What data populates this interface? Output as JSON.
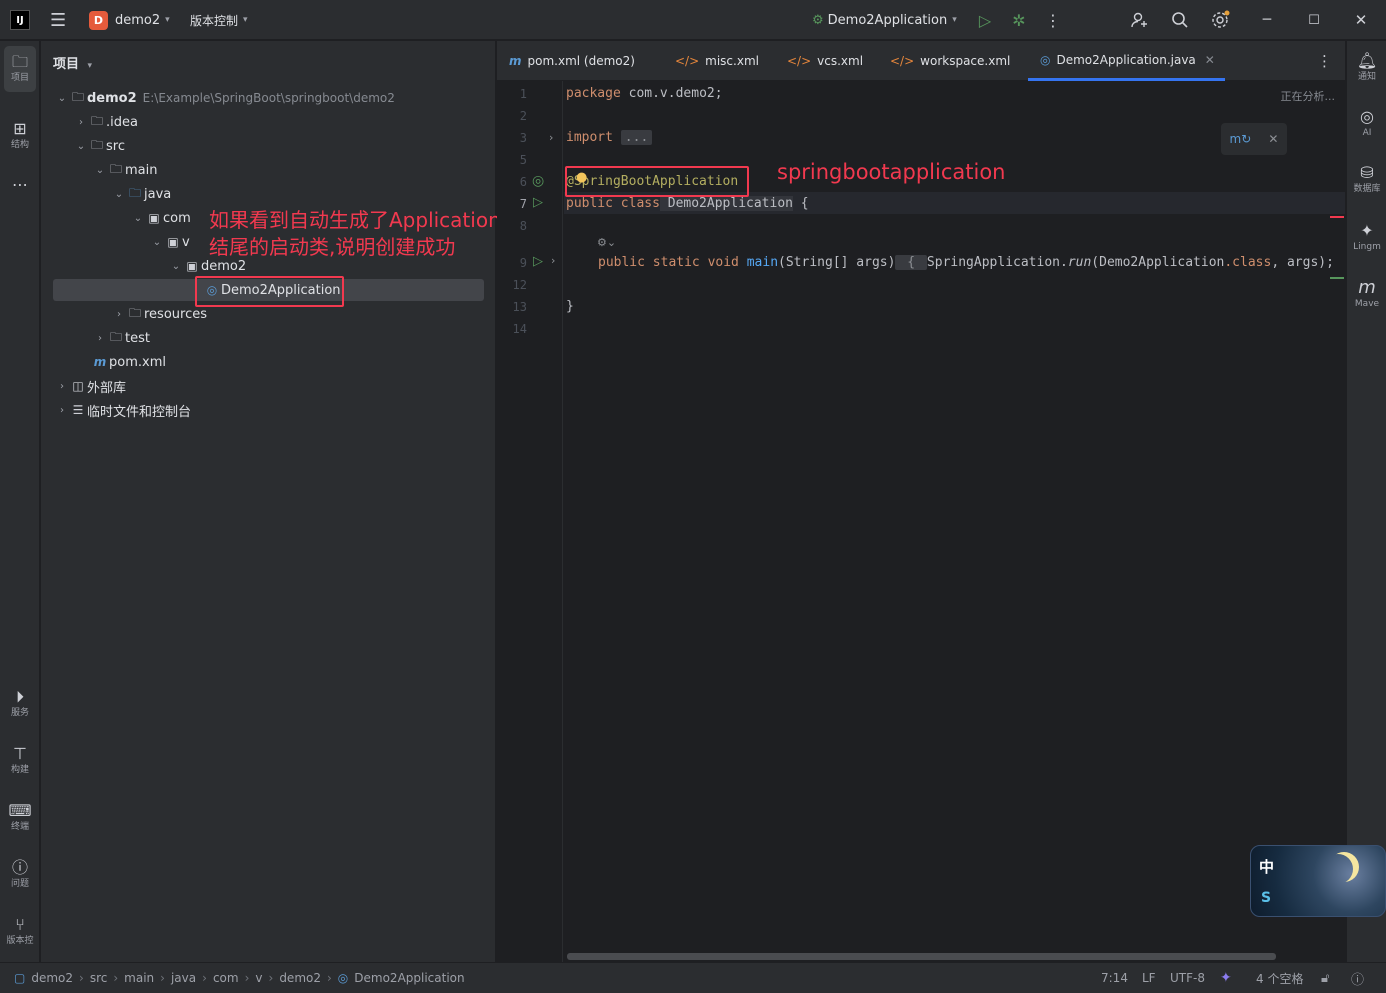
{
  "titlebar": {
    "logo": "IJ",
    "project_badge": "D",
    "project_name": "demo2",
    "vcs_label": "版本控制",
    "run_config": "Demo2Application"
  },
  "left_strip": {
    "items": [
      {
        "label": "项目",
        "icon": "folder-icon"
      },
      {
        "label": "结构",
        "icon": "structure-icon"
      },
      {
        "label": "服务",
        "icon": "services-icon"
      },
      {
        "label": "构建",
        "icon": "build-icon"
      },
      {
        "label": "终端",
        "icon": "terminal-icon"
      },
      {
        "label": "问题",
        "icon": "problems-icon"
      },
      {
        "label": "版本控",
        "icon": "git-icon"
      }
    ]
  },
  "project_panel": {
    "title": "项目",
    "tree": [
      {
        "name": "demo2",
        "path": "E:\\Example\\SpringBoot\\springboot\\demo2"
      },
      {
        "name": ".idea"
      },
      {
        "name": "src"
      },
      {
        "name": "main"
      },
      {
        "name": "java"
      },
      {
        "name": "com"
      },
      {
        "name": "v"
      },
      {
        "name": "demo2"
      },
      {
        "name": "Demo2Application"
      },
      {
        "name": "resources"
      },
      {
        "name": "test"
      },
      {
        "name": "pom.xml"
      },
      {
        "name": "外部库"
      },
      {
        "name": "临时文件和控制台"
      }
    ],
    "annotation_line1": "如果看到自动生成了Application",
    "annotation_line2": "结尾的启动类,说明创建成功"
  },
  "editor": {
    "tabs": [
      {
        "label": "pom.xml (demo2)",
        "icon": "maven-icon"
      },
      {
        "label": "misc.xml",
        "icon": "xml-icon"
      },
      {
        "label": "vcs.xml",
        "icon": "xml-icon"
      },
      {
        "label": "workspace.xml",
        "icon": "xml-icon"
      },
      {
        "label": "Demo2Application.java",
        "icon": "spring-class-icon",
        "active": true
      }
    ],
    "analyzing": "正在分析...",
    "line_numbers": [
      "1",
      "2",
      "3",
      "5",
      "6",
      "7",
      "8",
      "9",
      "12",
      "13",
      "14"
    ],
    "code": {
      "package_kw": "package",
      "package_name": " com.v.demo2;",
      "import_kw": "import",
      "import_fold": "...",
      "annotation": "@SpringBootApplication",
      "class_line_kw": "public class",
      "class_name": " Demo2Application",
      "class_brace": " {",
      "main_mods": "public static void",
      "main_name": " main",
      "main_params": "(String[] args)",
      "main_body_open": " { ",
      "main_body_call": "SpringApplication.",
      "main_body_run": "run",
      "main_body_arg": "(Demo2Application",
      "main_body_class": ".class",
      "main_body_end": ", args);",
      "close_brace": "}"
    },
    "annotation_label": "springbootapplication"
  },
  "right_strip": {
    "items": [
      {
        "label": "通知",
        "icon": "bell-icon"
      },
      {
        "label": "AI",
        "icon": "ai-icon"
      },
      {
        "label": "数据库",
        "icon": "database-icon"
      },
      {
        "label": "Lingm",
        "icon": "lingma-icon"
      },
      {
        "label": "Mave",
        "icon": "maven-icon"
      }
    ]
  },
  "ime": {
    "label": "中"
  },
  "statusbar": {
    "breadcrumb": [
      "demo2",
      "src",
      "main",
      "java",
      "com",
      "v",
      "demo2",
      "Demo2Application"
    ],
    "position": "7:14",
    "line_sep": "LF",
    "encoding": "UTF-8",
    "indent": "4 个空格"
  },
  "colors": {
    "accent": "#3574f0",
    "annotation_red": "#f2394f",
    "run_green": "#57965c"
  }
}
